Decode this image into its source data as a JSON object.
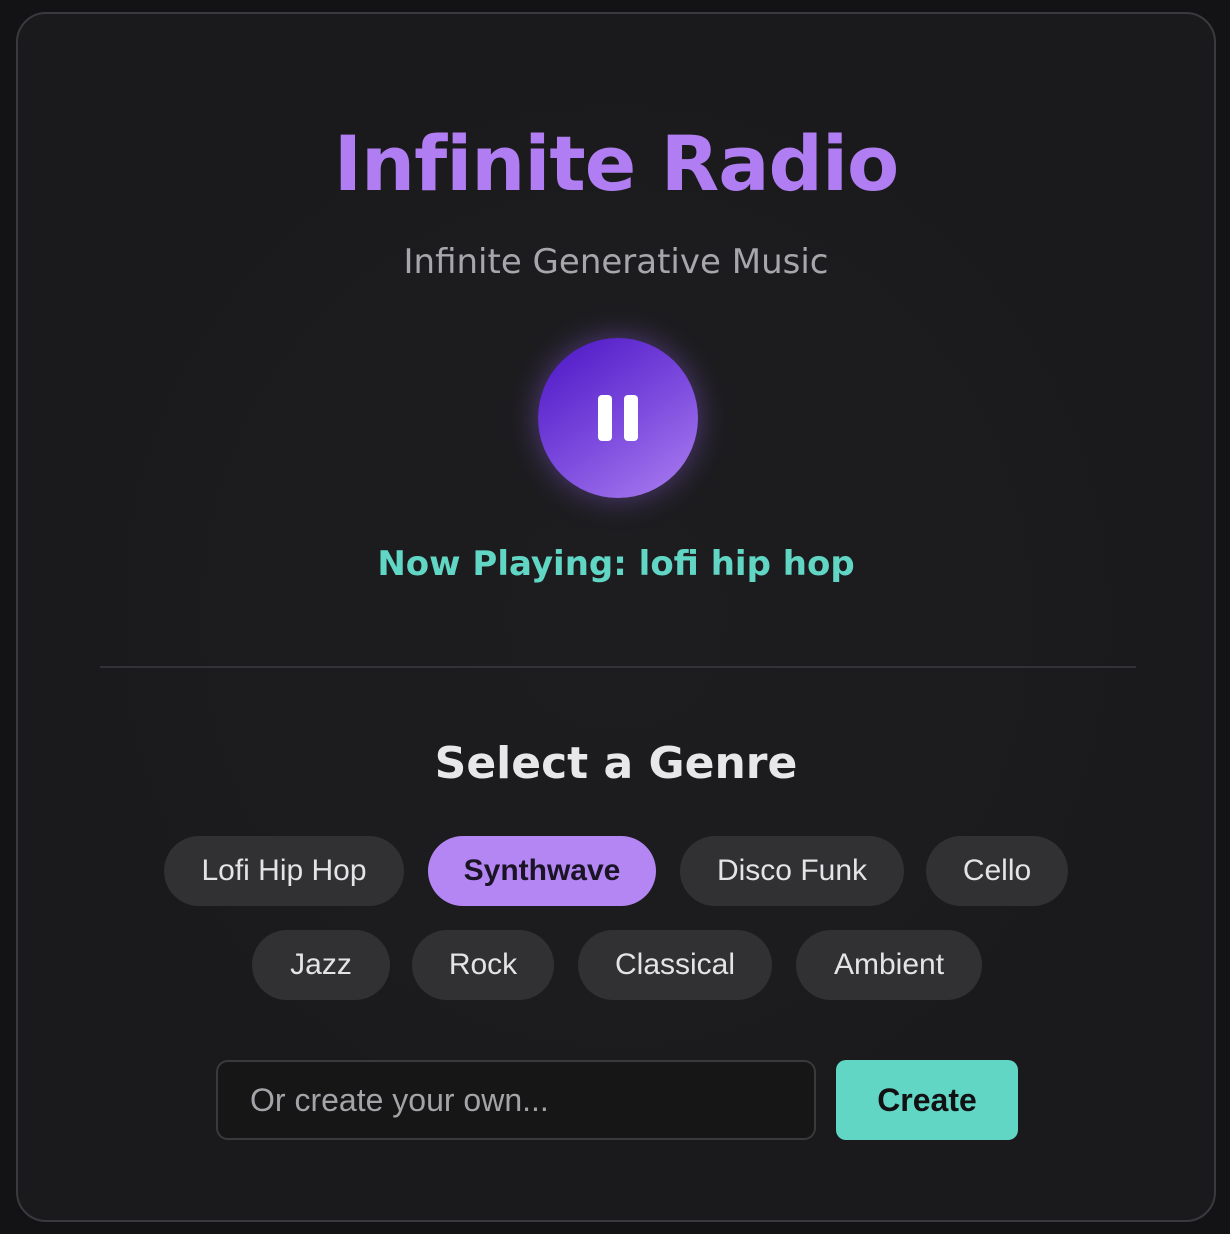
{
  "app": {
    "title": "Infinite Radio",
    "subtitle": "Infinite Generative Music"
  },
  "player": {
    "state": "playing",
    "control_icon": "pause-icon",
    "now_playing": "Now Playing: lofi hip hop"
  },
  "genres": {
    "heading": "Select a Genre",
    "selected": "Synthwave",
    "items": [
      {
        "label": "Lofi Hip Hop"
      },
      {
        "label": "Synthwave"
      },
      {
        "label": "Disco Funk"
      },
      {
        "label": "Cello"
      },
      {
        "label": "Jazz"
      },
      {
        "label": "Rock"
      },
      {
        "label": "Classical"
      },
      {
        "label": "Ambient"
      }
    ]
  },
  "custom": {
    "placeholder": "Or create your own...",
    "value": "",
    "button_label": "Create"
  },
  "colors": {
    "accent_purple": "#b07ef2",
    "accent_teal": "#62d6c5",
    "background": "#1c1c1e"
  }
}
